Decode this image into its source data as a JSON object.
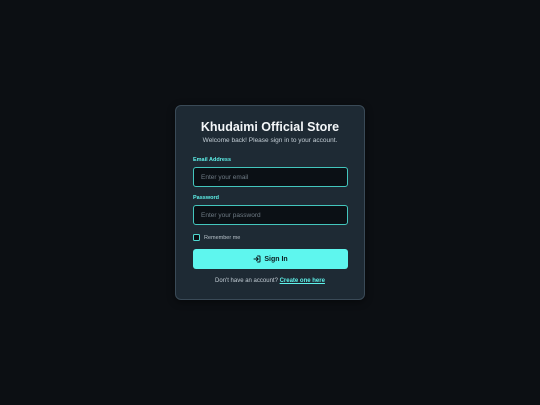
{
  "card": {
    "title": "Khudaimi Official Store",
    "subtitle": "Welcome back! Please sign in to your account."
  },
  "form": {
    "email_label": "Email Address",
    "email_placeholder": "Enter your email",
    "email_value": "",
    "password_label": "Password",
    "password_placeholder": "Enter your password",
    "password_value": "",
    "remember_label": "Remember me",
    "remember_checked": false,
    "signin_label": "Sign In",
    "signin_icon": "sign-in-icon"
  },
  "footer": {
    "prompt": "Don't have an account?",
    "link_label": "Create one here"
  },
  "colors": {
    "background": "#0c0f13",
    "card": "#1e2a34",
    "accent": "#5ef6ee"
  }
}
